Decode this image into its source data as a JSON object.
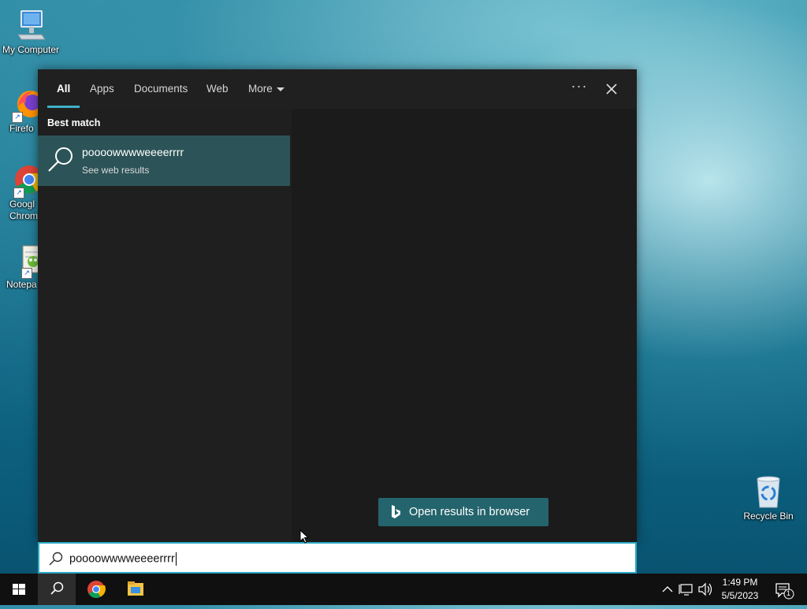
{
  "desktop": {
    "icons": [
      {
        "label": "My Computer",
        "icon": "my-computer-icon"
      },
      {
        "label": "Firefo",
        "icon": "firefox-icon"
      },
      {
        "label": "Googl\nChrom",
        "icon": "chrome-icon"
      },
      {
        "label": "Notepa",
        "icon": "notepad-icon"
      },
      {
        "label": "Recycle Bin",
        "icon": "recycle-bin-icon"
      }
    ]
  },
  "search": {
    "tabs": [
      "All",
      "Apps",
      "Documents",
      "Web",
      "More"
    ],
    "active_tab": "All",
    "more_options_label": "···",
    "best_match_heading": "Best match",
    "result": {
      "title": "poooowwwweeeerrrr",
      "subtitle": "See web results",
      "icon": "search-icon"
    },
    "open_browser_label": "Open results in browser",
    "query": "poooowwwweeeerrrr",
    "accent": "#3fb0c8"
  },
  "taskbar": {
    "pinned": [
      "start-icon",
      "search-icon",
      "chrome-icon",
      "file-explorer-icon"
    ],
    "time": "1:49 PM",
    "date": "5/5/2023",
    "notification_count": "1"
  }
}
